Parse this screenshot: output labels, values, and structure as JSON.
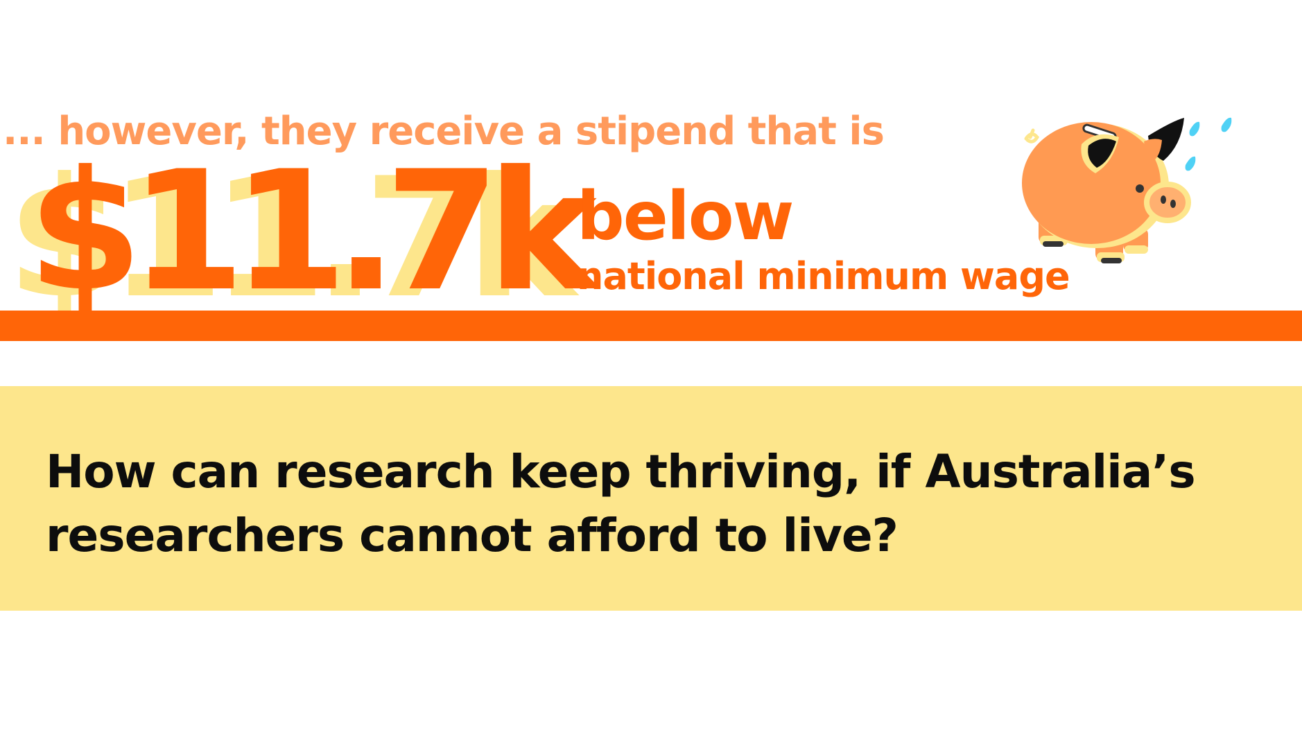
{
  "headline": {
    "intro": "... however, they receive a stipend that is",
    "amount": "$11.7k",
    "below": "below",
    "comparison": "national minimum wage"
  },
  "question": {
    "text": "How can research keep thriving, if Australia’s researchers cannot afford to live?"
  },
  "illustration": {
    "icon": "crying-piggy-bank-icon"
  },
  "colors": {
    "accent_orange": "#ff6508",
    "light_orange": "#ff9a5c",
    "pale_yellow": "#fde68c",
    "pig_body": "#ff9a52",
    "tear_blue": "#4fd1f5",
    "text_dark": "#0d0d0d"
  }
}
